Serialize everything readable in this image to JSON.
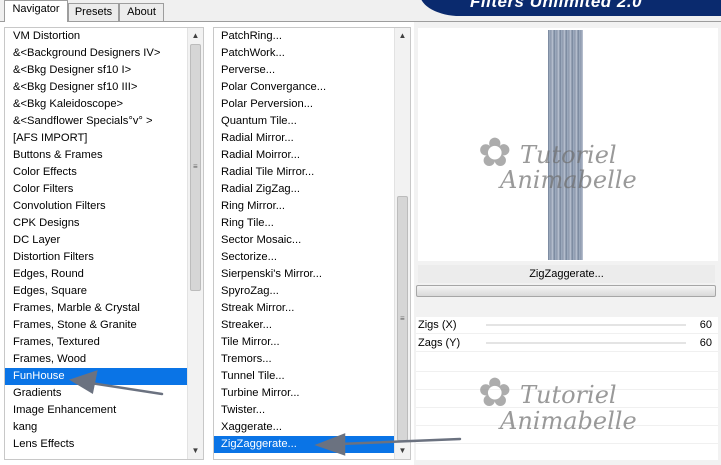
{
  "tabs": [
    {
      "label": "Navigator",
      "active": true
    },
    {
      "label": "Presets",
      "active": false
    },
    {
      "label": "About",
      "active": false
    }
  ],
  "banner": {
    "title": "Filters Unlimited 2.0",
    "color": "#0a2a6e"
  },
  "categories": {
    "items": [
      "VM Distortion",
      "&<Background Designers IV>",
      "&<Bkg Designer sf10 I>",
      "&<Bkg Designer sf10 III>",
      "&<Bkg Kaleidoscope>",
      "&<Sandflower Specials°v° >",
      "[AFS IMPORT]",
      "Buttons & Frames",
      "Color Effects",
      "Color Filters",
      "Convolution Filters",
      "CPK Designs",
      "DC Layer",
      "Distortion Filters",
      "Edges, Round",
      "Edges, Square",
      "Frames, Marble & Crystal",
      "Frames, Stone & Granite",
      "Frames, Textured",
      "Frames, Wood",
      "FunHouse",
      "Gradients",
      "Image Enhancement",
      "kang",
      "Lens Effects"
    ],
    "selected_index": 20
  },
  "filters": {
    "items": [
      "PatchRing...",
      "PatchWork...",
      "Perverse...",
      "Polar Convergance...",
      "Polar Perversion...",
      "Quantum Tile...",
      "Radial Mirror...",
      "Radial Moirror...",
      "Radial Tile Mirror...",
      "Radial ZigZag...",
      "Ring Mirror...",
      "Ring Tile...",
      "Sector Mosaic...",
      "Sectorize...",
      "Sierpenski's Mirror...",
      "SpyroZag...",
      "Streak Mirror...",
      "Streaker...",
      "Tile Mirror...",
      "Tremors...",
      "Tunnel Tile...",
      "Turbine Mirror...",
      "Twister...",
      "Xaggerate...",
      "ZigZaggerate..."
    ],
    "selected_index": 24,
    "selected_color": "#0a74e6"
  },
  "preview": {
    "filter_name": "ZigZaggerate...",
    "watermark_line1": "Tutoriel",
    "watermark_line2": "Animabelle"
  },
  "params": [
    {
      "label": "Zigs (X)",
      "value": "60"
    },
    {
      "label": "Zags (Y)",
      "value": "60"
    }
  ],
  "annotation_color": "#6b7280"
}
